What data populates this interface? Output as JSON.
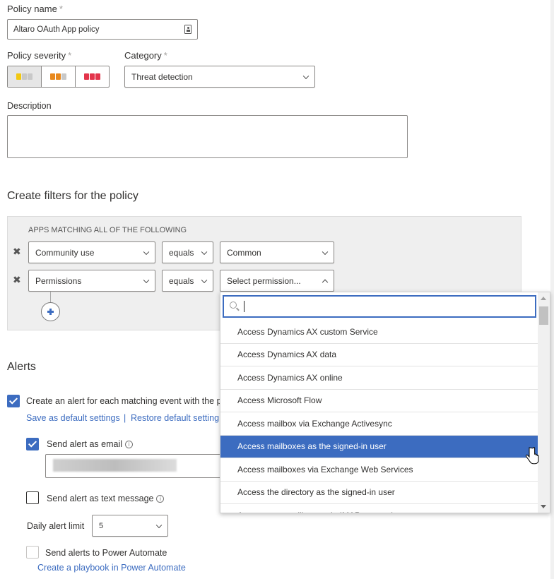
{
  "policy_name": {
    "label": "Policy name",
    "required_mark": "*",
    "value": "Altaro OAuth App policy"
  },
  "policy_severity": {
    "label": "Policy severity",
    "required_mark": "*",
    "options": [
      "low",
      "medium",
      "high"
    ],
    "selected": "low",
    "colors": {
      "low": "#f2c811",
      "medium": "#e8891e",
      "high": "#e3344b",
      "inactive": "#c8c8c8"
    }
  },
  "category": {
    "label": "Category",
    "required_mark": "*",
    "value": "Threat detection"
  },
  "description": {
    "label": "Description",
    "value": ""
  },
  "filters": {
    "heading": "Create filters for the policy",
    "group_label": "APPS MATCHING ALL OF THE FOLLOWING",
    "rows": [
      {
        "field": "Community use",
        "operator": "equals",
        "value": "Common"
      },
      {
        "field": "Permissions",
        "operator": "equals",
        "value": "Select permission..."
      }
    ]
  },
  "permission_dropdown": {
    "search_value": "",
    "items": [
      "Access Dynamics AX custom Service",
      "Access Dynamics AX data",
      "Access Dynamics AX online",
      "Access Microsoft Flow",
      "Access mailbox via Exchange Activesync",
      "Access mailboxes as the signed-in user",
      "Access mailboxes via Exchange Web Services",
      "Access the directory as the signed-in user",
      "Access user mailboxes via IMAP protocol"
    ],
    "highlighted": "Access mailboxes as the signed-in user"
  },
  "alerts": {
    "heading": "Alerts",
    "create_alert": {
      "label": "Create an alert for each matching event with the p",
      "checked": true
    },
    "save_default": "Save as default settings",
    "separator": "|",
    "restore_default": "Restore default setting",
    "send_email": {
      "label": "Send alert as email",
      "checked": true,
      "value": ""
    },
    "send_text": {
      "label": "Send alert as text message",
      "checked": false
    },
    "daily_limit": {
      "label": "Daily alert limit",
      "value": "5"
    },
    "power_automate": {
      "label": "Send alerts to Power Automate",
      "checked": false
    },
    "playbook_link": "Create a playbook in Power Automate"
  },
  "accent_color": "#3c6cc0"
}
